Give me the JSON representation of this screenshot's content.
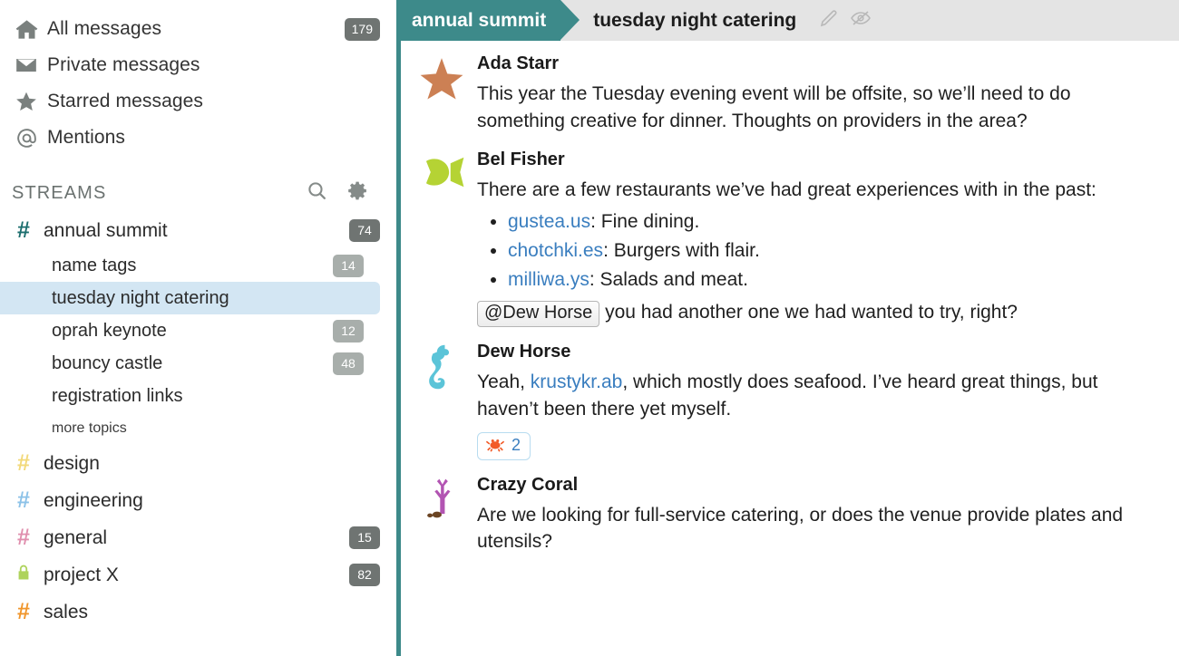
{
  "sidebar": {
    "nav": [
      {
        "label": "All messages",
        "icon": "home-icon",
        "count": "179",
        "badge": "dark"
      },
      {
        "label": "Private messages",
        "icon": "envelope-icon",
        "count": "",
        "badge": ""
      },
      {
        "label": "Starred messages",
        "icon": "star-icon",
        "count": "",
        "badge": ""
      },
      {
        "label": "Mentions",
        "icon": "at-icon",
        "count": "",
        "badge": ""
      }
    ],
    "streams_header": {
      "title": "STREAMS",
      "search_icon": "search-icon",
      "settings_icon": "gear-icon"
    },
    "streams": [
      {
        "name": "annual summit",
        "hash": "#",
        "color": "#1c6e6e",
        "count": "74",
        "badge": "dark"
      },
      {
        "name": "design",
        "hash": "#",
        "color": "#f2d97a",
        "count": "",
        "badge": ""
      },
      {
        "name": "engineering",
        "hash": "#",
        "color": "#8cc2e8",
        "count": "",
        "badge": ""
      },
      {
        "name": "general",
        "hash": "#",
        "color": "#e08fae",
        "count": "15",
        "badge": "dark"
      },
      {
        "name": "project X",
        "hash": "🔒",
        "color": "#aed35c",
        "count": "82",
        "badge": "dark"
      },
      {
        "name": "sales",
        "hash": "#",
        "color": "#f0962c",
        "count": "",
        "badge": ""
      }
    ],
    "topics": [
      {
        "name": "name tags",
        "count": "14",
        "selected": false
      },
      {
        "name": "tuesday night catering",
        "count": "",
        "selected": true
      },
      {
        "name": "oprah keynote",
        "count": "12",
        "selected": false
      },
      {
        "name": "bouncy castle",
        "count": "48",
        "selected": false
      },
      {
        "name": "registration links",
        "count": "",
        "selected": false
      }
    ],
    "more_topics_label": "more topics"
  },
  "topbar": {
    "stream": "annual summit",
    "topic": "tuesday night catering",
    "edit_icon": "pencil-icon",
    "mute_icon": "eye-slash-icon",
    "accent_color": "#3d8a8a"
  },
  "messages": [
    {
      "sender": "Ada Starr",
      "avatar": "starfish-avatar",
      "emoji": "🌟",
      "text": "This year the Tuesday evening event will be offsite, so we’ll need to do something creative for dinner. Thoughts on providers in the area?"
    },
    {
      "sender": "Bel Fisher",
      "avatar": "fish-avatar",
      "emoji": "🐠",
      "text": "There are a few restaurants we’ve had great experiences with in the past:",
      "list": [
        {
          "link": "gustea.us",
          "rest": ": Fine dining."
        },
        {
          "link": "chotchki.es",
          "rest": ": Burgers with flair."
        },
        {
          "link": "milliwa.ys",
          "rest": ": Salads and meat."
        }
      ],
      "mention": "@Dew Horse",
      "mention_rest": "you had another one we had wanted to try, right?"
    },
    {
      "sender": "Dew Horse",
      "avatar": "seahorse-avatar",
      "emoji": "🦄",
      "text_before": "Yeah, ",
      "link": "krustykr.ab",
      "text_after": ", which mostly does seafood. I’ve heard great things, but haven’t been there yet myself.",
      "reaction": {
        "emoji": "🦀",
        "name": "crab-emoji",
        "count": "2"
      }
    },
    {
      "sender": "Crazy Coral",
      "avatar": "coral-avatar",
      "emoji": "🪸",
      "text": "Are we looking for full-service catering, or does the venue provide plates and utensils?"
    }
  ]
}
